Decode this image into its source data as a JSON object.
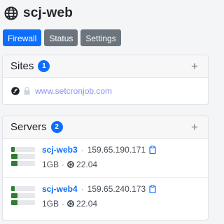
{
  "app": {
    "title": "scj-web",
    "icon": "globe-icon"
  },
  "tabs": [
    {
      "label": "Firewall",
      "active": true
    },
    {
      "label": "Status",
      "active": false
    },
    {
      "label": "Settings",
      "active": false
    }
  ],
  "sites": {
    "title": "Sites",
    "count": "1",
    "add_icon": "+",
    "items": [
      {
        "url": "www.setcronjob.com",
        "framework_icon": "symfony-icon",
        "lock_icon": "lock-icon"
      }
    ]
  },
  "servers": {
    "title": "Servers",
    "count": "2",
    "add_icon": "+",
    "items": [
      {
        "name": "scj-web3",
        "ip": "159.65.190.171",
        "memory": "1GB",
        "os_version": "22.04",
        "separator": "·"
      },
      {
        "name": "scj-web4",
        "ip": "159.65.240.173",
        "memory": "1GB",
        "os_version": "22.04",
        "separator": "·"
      }
    ]
  },
  "colors": {
    "primary": "#0d6efd",
    "secondary": "#6c757d",
    "server_green": "#2e7d32",
    "link": "#8a93f0"
  }
}
